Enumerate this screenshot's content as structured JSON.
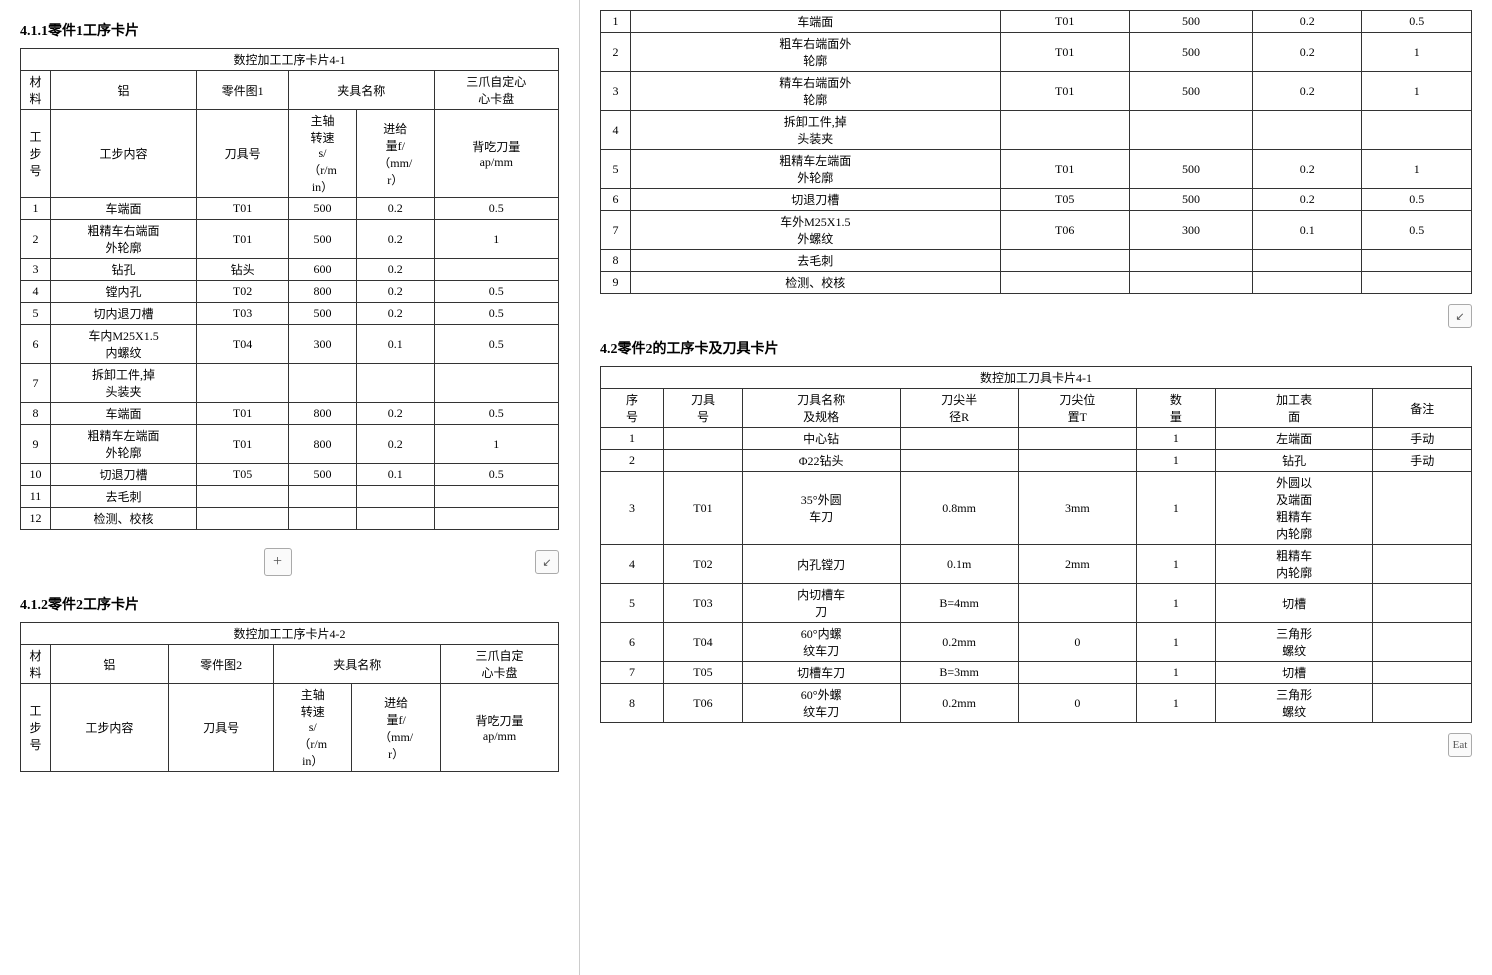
{
  "left": {
    "section1_title": "4.1.1零件1工序卡片",
    "table1_caption": "数控加工工序卡片4-1",
    "table1_meta": [
      {
        "label1": "材料",
        "val1": "铝",
        "label2": "零件图1",
        "label3": "夹具名称",
        "label4": "三爪自定心卡盘"
      },
      {
        "label1": "工步号",
        "val1": "工步内容",
        "label2": "刀具号",
        "label3": "主轴转速s/（r/min）",
        "label4": "进给量f/（mm/r）",
        "label5": "背吃刀量ap/mm"
      }
    ],
    "table1_rows": [
      {
        "no": "1",
        "content": "车端面",
        "tool": "T01",
        "speed": "500",
        "feed": "0.2",
        "depth": "0.5"
      },
      {
        "no": "2",
        "content": "粗精车右端面外轮廓",
        "tool": "T01",
        "speed": "500",
        "feed": "0.2",
        "depth": "1"
      },
      {
        "no": "3",
        "content": "钻孔",
        "tool": "钻头",
        "speed": "600",
        "feed": "0.2",
        "depth": ""
      },
      {
        "no": "4",
        "content": "镗内孔",
        "tool": "T02",
        "speed": "800",
        "feed": "0.2",
        "depth": "0.5"
      },
      {
        "no": "5",
        "content": "切内退刀槽",
        "tool": "T03",
        "speed": "500",
        "feed": "0.2",
        "depth": "0.5"
      },
      {
        "no": "6",
        "content": "车内M25X1.5内螺纹",
        "tool": "T04",
        "speed": "300",
        "feed": "0.1",
        "depth": "0.5"
      },
      {
        "no": "7",
        "content": "拆卸工件,掉头装夹",
        "tool": "",
        "speed": "",
        "feed": "",
        "depth": ""
      },
      {
        "no": "8",
        "content": "车端面",
        "tool": "T01",
        "speed": "800",
        "feed": "0.2",
        "depth": "0.5"
      },
      {
        "no": "9",
        "content": "粗精车左端面外轮廓",
        "tool": "T01",
        "speed": "800",
        "feed": "0.2",
        "depth": "1"
      },
      {
        "no": "10",
        "content": "切退刀槽",
        "tool": "T05",
        "speed": "500",
        "feed": "0.1",
        "depth": "0.5"
      },
      {
        "no": "11",
        "content": "去毛刺",
        "tool": "",
        "speed": "",
        "feed": "",
        "depth": ""
      },
      {
        "no": "12",
        "content": "检测、校核",
        "tool": "",
        "speed": "",
        "feed": "",
        "depth": ""
      }
    ],
    "section2_title": "4.1.2零件2工序卡片",
    "table2_caption": "数控加工工序卡片4-2",
    "table2_meta_material": "铝",
    "table2_meta_part": "零件图2",
    "table2_meta_clamp": "夹具名称",
    "table2_meta_clamp_val": "三爪自定心卡盘"
  },
  "right": {
    "table_right1_rows": [
      {
        "no": "1",
        "content": "车端面",
        "tool": "T01",
        "speed": "500",
        "feed": "0.2",
        "depth": "0.5"
      },
      {
        "no": "2",
        "content": "粗车右端面外轮廓",
        "tool": "T01",
        "speed": "500",
        "feed": "0.2",
        "depth": "1"
      },
      {
        "no": "3",
        "content": "精车右端面外轮廓",
        "tool": "T01",
        "speed": "500",
        "feed": "0.2",
        "depth": "1"
      },
      {
        "no": "4",
        "content": "拆卸工件,掉头装夹",
        "tool": "",
        "speed": "",
        "feed": "",
        "depth": ""
      },
      {
        "no": "5",
        "content": "粗精车左端面外轮廓",
        "tool": "T01",
        "speed": "500",
        "feed": "0.2",
        "depth": "1"
      },
      {
        "no": "6",
        "content": "切退刀槽",
        "tool": "T05",
        "speed": "500",
        "feed": "0.2",
        "depth": "0.5"
      },
      {
        "no": "7",
        "content": "车外M25X1.5外螺纹",
        "tool": "T06",
        "speed": "300",
        "feed": "0.1",
        "depth": "0.5"
      },
      {
        "no": "8",
        "content": "去毛刺",
        "tool": "",
        "speed": "",
        "feed": "",
        "depth": ""
      },
      {
        "no": "9",
        "content": "检测、校核",
        "tool": "",
        "speed": "",
        "feed": "",
        "depth": ""
      }
    ],
    "section2_title": "4.2零件2的工序卡及刀具卡片",
    "tool_card_caption": "数控加工刀具卡片4-1",
    "tool_card_headers": [
      "序号",
      "刀具号",
      "刀具名称及规格",
      "刀尖半径R",
      "刀尖位置T",
      "数量",
      "加工表面",
      "备注"
    ],
    "tool_card_rows": [
      {
        "no": "1",
        "tool_no": "",
        "name": "中心钻",
        "radius": "",
        "pos": "",
        "qty": "1",
        "surface": "左端面",
        "note": "手动"
      },
      {
        "no": "2",
        "tool_no": "",
        "name": "Φ22钻头",
        "radius": "",
        "pos": "",
        "qty": "1",
        "surface": "钻孔",
        "note": "手动"
      },
      {
        "no": "3",
        "tool_no": "T01",
        "name": "35°外圆车刀",
        "radius": "0.8mm",
        "pos": "3mm",
        "qty": "1",
        "surface": "外圆以及端面粗精车内轮廓",
        "note": ""
      },
      {
        "no": "4",
        "tool_no": "T02",
        "name": "内孔镗刀",
        "radius": "0.1m",
        "pos": "2mm",
        "qty": "1",
        "surface": "粗精车内轮廓",
        "note": ""
      },
      {
        "no": "5",
        "tool_no": "T03",
        "name": "内切槽车刀",
        "radius": "B=4mm",
        "pos": "",
        "qty": "1",
        "surface": "切槽",
        "note": ""
      },
      {
        "no": "6",
        "tool_no": "T04",
        "name": "60°内螺纹车刀",
        "radius": "0.2mm",
        "pos": "0",
        "qty": "1",
        "surface": "三角形螺纹",
        "note": ""
      },
      {
        "no": "7",
        "tool_no": "T05",
        "name": "切槽车刀",
        "radius": "B=3mm",
        "pos": "",
        "qty": "1",
        "surface": "切槽",
        "note": ""
      },
      {
        "no": "8",
        "tool_no": "T06",
        "name": "60°外螺纹车刀",
        "radius": "0.2mm",
        "pos": "0",
        "qty": "1",
        "surface": "三角形螺纹",
        "note": ""
      }
    ]
  },
  "buttons": {
    "plus": "+",
    "shrink": "↙"
  }
}
